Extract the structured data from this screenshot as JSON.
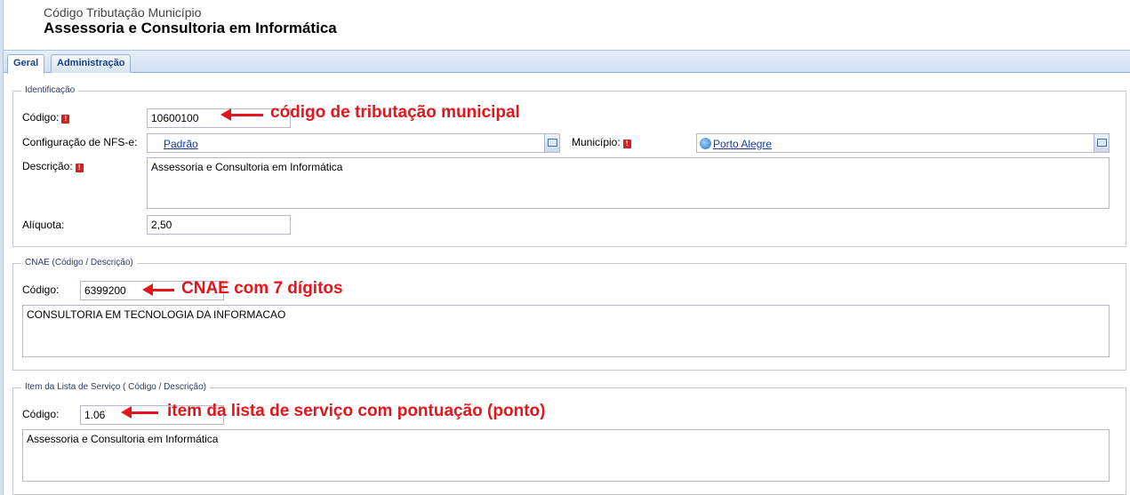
{
  "header": {
    "subtitle": "Código Tributação Município",
    "title": "Assessoria e Consultoria em Informática"
  },
  "tabs": [
    {
      "label": "Geral",
      "active": true
    },
    {
      "label": "Administração",
      "active": false
    }
  ],
  "identificacao": {
    "legend": "Identificação",
    "codigo_label": "Código:",
    "codigo_value": "10600100",
    "nfse_label": "Configuração de NFS-e:",
    "nfse_value": "Padrão",
    "municipio_label": "Município:",
    "municipio_value": "Porto Alegre",
    "descricao_label": "Descrição:",
    "descricao_value": "Assessoria e Consultoria em Informática",
    "aliquota_label": "Alíquota:",
    "aliquota_value": "2,50"
  },
  "cnae": {
    "legend": "CNAE (Código / Descrição)",
    "codigo_label": "Código:",
    "codigo_value": "6399200",
    "descricao_value": "CONSULTORIA EM TECNOLOGIA DA INFORMACAO"
  },
  "item_lista": {
    "legend": "Item da Lista de Serviço ( Código / Descrição)",
    "codigo_label": "Código:",
    "codigo_value": "1.06",
    "descricao_value": "Assessoria e Consultoria em Informática"
  },
  "annotations": {
    "codigo_tributacao": "código de tributação municipal",
    "cnae": "CNAE com 7 dígitos",
    "item_lista": "item da lista de serviço com pontuação (ponto)"
  },
  "colors": {
    "annotation": "#e4151c",
    "required_marker": "#d32020",
    "tab_text": "#15428b"
  }
}
